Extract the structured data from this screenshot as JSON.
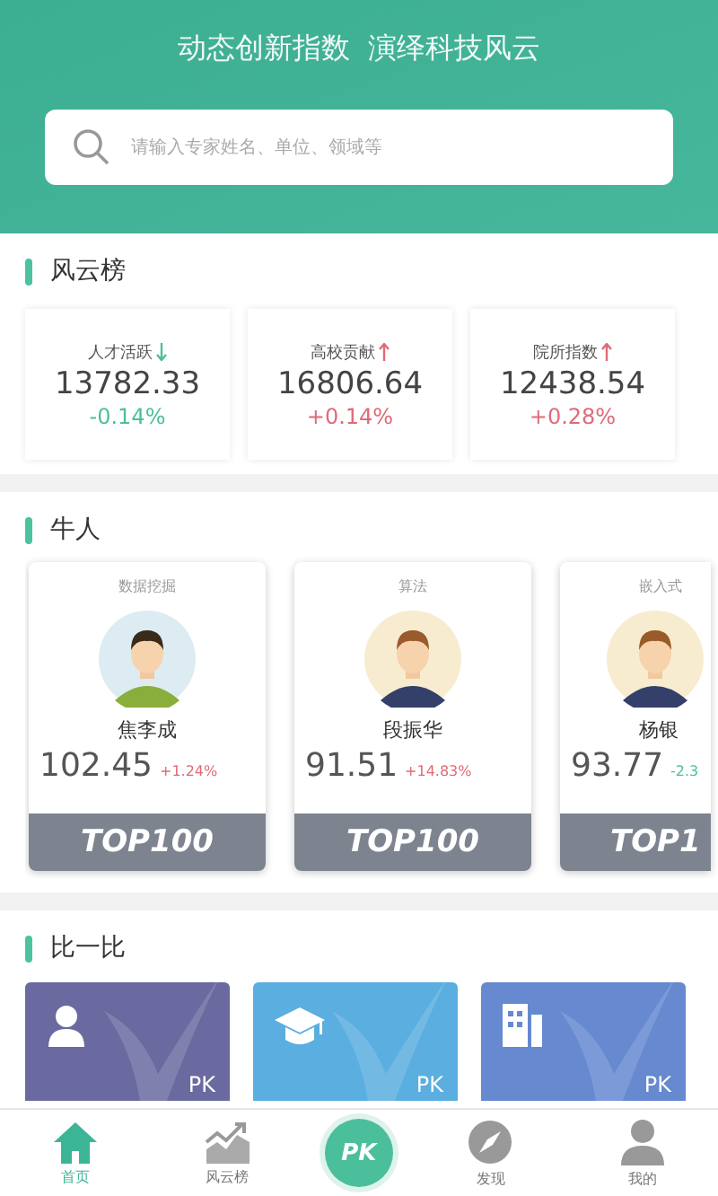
{
  "header": {
    "slogan": "动态创新指数  演绎科技风云",
    "search": {
      "placeholder": "请输入专家姓名、单位、领域等"
    }
  },
  "ranking": {
    "title": "风云榜",
    "indices": [
      {
        "label": "人才活跃",
        "kind": "down",
        "value": "13782.33",
        "change": "-0.14%"
      },
      {
        "label": "高校贡献",
        "kind": "up",
        "value": "16806.64",
        "change": "+0.14%"
      },
      {
        "label": "院所指数",
        "kind": "up",
        "value": "12438.54",
        "change": "+0.28%"
      }
    ]
  },
  "experts": {
    "title": "牛人",
    "cards": [
      {
        "field": "数据挖掘",
        "name": "焦李成",
        "score": "102.45",
        "kind": "up",
        "change": "+1.24%",
        "badge": "TOP100"
      },
      {
        "field": "算法",
        "name": "段振华",
        "score": "91.51",
        "kind": "up",
        "change": "+14.83%",
        "badge": "TOP100"
      },
      {
        "field": "嵌入式",
        "name": "杨银",
        "score": "93.77",
        "kind": "down",
        "change": "-2.3",
        "badge": "TOP1"
      }
    ]
  },
  "compare": {
    "title": "比一比",
    "cards": [
      {
        "kind": "person",
        "color": "#6a6aa0",
        "label": "PK"
      },
      {
        "kind": "cap",
        "color": "#5aaee0",
        "label": "PK"
      },
      {
        "kind": "building",
        "color": "#6689d0",
        "label": "PK"
      }
    ]
  },
  "nav": [
    {
      "kind": "home",
      "label": "首页",
      "selected": true
    },
    {
      "kind": "chart",
      "label": "风云榜",
      "selected": false
    },
    {
      "kind": "pk",
      "label": "PK",
      "selected": false
    },
    {
      "kind": "compass",
      "label": "发现",
      "selected": false
    },
    {
      "kind": "user",
      "label": "我的",
      "selected": false
    }
  ]
}
